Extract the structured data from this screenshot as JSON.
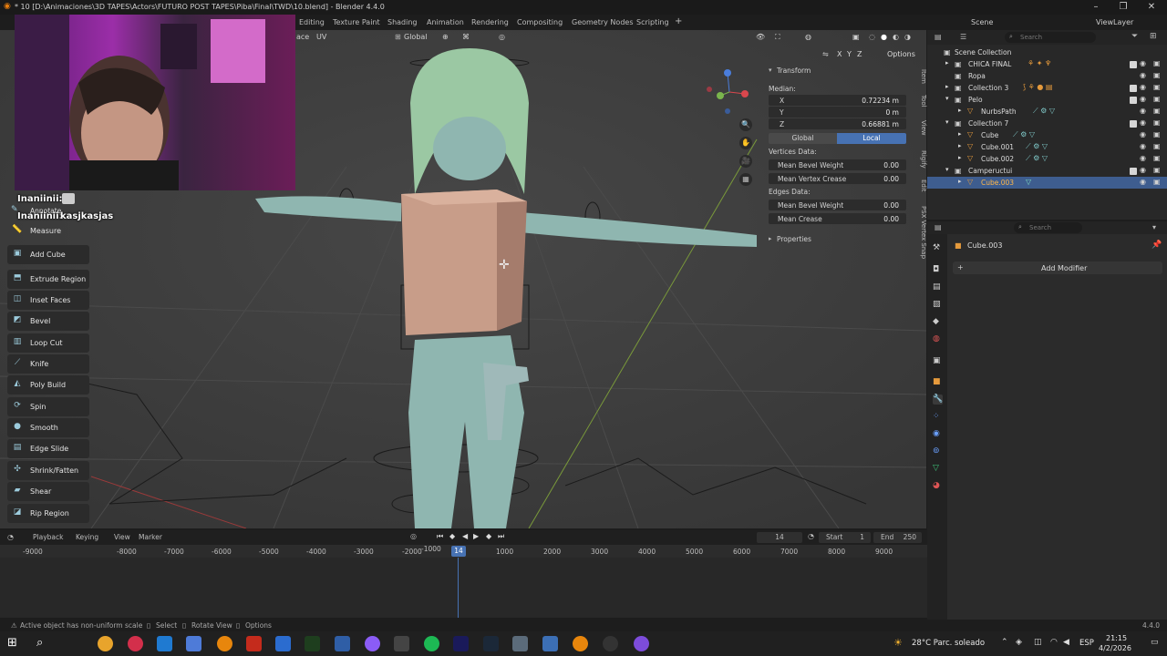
{
  "window": {
    "title": "* 10 [D:\\Animaciones\\3D TAPES\\Actors\\FUTURO POST TAPES\\Piba\\Final\\TWD\\10.blend] - Blender 4.4.0",
    "controls": [
      "–",
      "❐",
      "✕"
    ]
  },
  "workspace_tabs": [
    "Editing",
    "Texture Paint",
    "Shading",
    "Animation",
    "Rendering",
    "Compositing",
    "Geometry Nodes",
    "Scripting",
    "+"
  ],
  "scene": {
    "label": "Scene",
    "view_layer": "ViewLayer"
  },
  "viewport_header": {
    "mode_fragment": "ace",
    "uv_menu": "UV",
    "orientation": "Global",
    "options_label": "Options",
    "axes": [
      "X",
      "Y",
      "Z"
    ]
  },
  "chat": {
    "user1": "Inaniinii:",
    "user2": "Inaniinii:",
    "message": "kasjkasjas"
  },
  "toolbar": {
    "items": [
      {
        "label": "Annotate",
        "icon": "annotate-icon"
      },
      {
        "label": "Measure",
        "icon": "measure-icon"
      },
      {
        "label": "Add Cube",
        "icon": "add-cube-icon"
      },
      {
        "label": "Extrude Region",
        "icon": "extrude-icon"
      },
      {
        "label": "Inset Faces",
        "icon": "inset-icon"
      },
      {
        "label": "Bevel",
        "icon": "bevel-icon"
      },
      {
        "label": "Loop Cut",
        "icon": "loop-cut-icon"
      },
      {
        "label": "Knife",
        "icon": "knife-icon"
      },
      {
        "label": "Poly Build",
        "icon": "poly-build-icon"
      },
      {
        "label": "Spin",
        "icon": "spin-icon"
      },
      {
        "label": "Smooth",
        "icon": "smooth-icon"
      },
      {
        "label": "Edge Slide",
        "icon": "edge-slide-icon"
      },
      {
        "label": "Shrink/Fatten",
        "icon": "shrink-fatten-icon"
      },
      {
        "label": "Shear",
        "icon": "shear-icon"
      },
      {
        "label": "Rip Region",
        "icon": "rip-icon"
      }
    ]
  },
  "n_panel": {
    "transform_header": "Transform",
    "median_label": "Median:",
    "x_label": "X",
    "x_value": "0.72234 m",
    "y_label": "Y",
    "y_value": "0 m",
    "z_label": "Z",
    "z_value": "0.66881 m",
    "global_btn": "Global",
    "local_btn": "Local",
    "vertices_data": "Vertices Data:",
    "mean_bevel_weight_v": "Mean Bevel Weight",
    "mean_bevel_weight_v_val": "0.00",
    "mean_vertex_crease": "Mean Vertex Crease",
    "mean_vertex_crease_val": "0.00",
    "edges_data": "Edges Data:",
    "mean_bevel_weight_e": "Mean Bevel Weight",
    "mean_bevel_weight_e_val": "0.00",
    "mean_crease": "Mean Crease",
    "mean_crease_val": "0.00",
    "properties_header": "Properties"
  },
  "side_tabs": [
    "Item",
    "Tool",
    "View",
    "Rigify",
    "Edit",
    "PSX Vertex Snap"
  ],
  "outliner": {
    "search_placeholder": "Search",
    "rows": [
      {
        "name": "Scene Collection"
      },
      {
        "name": "CHICA FINAL"
      },
      {
        "name": "Ropa"
      },
      {
        "name": "Collection 3"
      },
      {
        "name": "Pelo"
      },
      {
        "name": "NurbsPath"
      },
      {
        "name": "Collection 7"
      },
      {
        "name": "Cube"
      },
      {
        "name": "Cube.001"
      },
      {
        "name": "Cube.002"
      },
      {
        "name": "Campeructui"
      },
      {
        "name": "Cube.003"
      }
    ]
  },
  "properties": {
    "search_placeholder": "Search",
    "object_name": "Cube.003",
    "add_modifier": "Add Modifier"
  },
  "timeline": {
    "menus": [
      "Playback",
      "Keying",
      "View",
      "Marker"
    ],
    "current_frame": "14",
    "start_label": "Start",
    "start_value": "1",
    "end_label": "End",
    "end_value": "250",
    "ruler": [
      "-9000",
      "-8000",
      "-7000",
      "-6000",
      "-5000",
      "-4000",
      "-3000",
      "-2000",
      "-1000",
      "14",
      "1000",
      "2000",
      "3000",
      "4000",
      "5000",
      "6000",
      "7000",
      "8000",
      "9000"
    ]
  },
  "status": {
    "message": "Active object has non-uniform scale",
    "select": "Select",
    "rotate": "Rotate View",
    "options": "Options",
    "version": "4.4.0"
  },
  "taskbar": {
    "weather": "28°C  Parc. soleado",
    "lang": "ESP",
    "time": "21:15",
    "date": "4/2/2026"
  }
}
